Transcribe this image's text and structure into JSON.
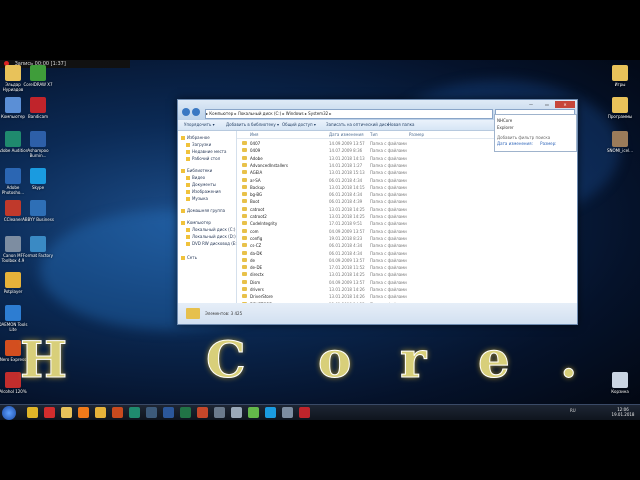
{
  "recording_bar": {
    "label": "Запись 00:00 [1:37]"
  },
  "desktop_icons_left": [
    {
      "label": "Эльдар Нуриадов",
      "icon": "user-folder-icon",
      "color": "#e8c25a"
    },
    {
      "label": "Компьютер",
      "icon": "computer-icon",
      "color": "#5b8fd6"
    },
    {
      "label": "Adobe Audition",
      "icon": "audition-icon",
      "color": "#1f8a6e"
    },
    {
      "label": "Adobe Photosho...",
      "icon": "photoshop-icon",
      "color": "#2b66b3"
    },
    {
      "label": "CCleaner",
      "icon": "ccleaner-icon",
      "color": "#c0392b"
    },
    {
      "label": "Canon MF Toolbox 4.9",
      "icon": "canon-icon",
      "color": "#7d8da1"
    },
    {
      "label": "Potplayer",
      "icon": "potplayer-icon",
      "color": "#e5b23a"
    },
    {
      "label": "DAEMON Tools Lite",
      "icon": "daemon-tools-icon",
      "color": "#2d7dd2"
    },
    {
      "label": "Nero Express",
      "icon": "nero-icon",
      "color": "#d34e1f"
    },
    {
      "label": "Alcohol 120%",
      "icon": "alcohol-icon",
      "color": "#c22d2d"
    }
  ],
  "desktop_icons_left2": [
    {
      "label": "CorelDRAW X7",
      "icon": "coreldraw-icon",
      "color": "#3f9d3a"
    },
    {
      "label": "Bandicam",
      "icon": "bandicam-icon",
      "color": "#c0242b"
    },
    {
      "label": "Ashampoo Burnin...",
      "icon": "ashampoo-icon",
      "color": "#2d5fa8"
    },
    {
      "label": "Skype",
      "icon": "skype-icon",
      "color": "#1a9be0"
    },
    {
      "label": "ABBYY Business",
      "icon": "abbyy-icon",
      "color": "#2e6fb6"
    },
    {
      "label": "Format Factory",
      "icon": "format-factory-icon",
      "color": "#3a8ac4"
    }
  ],
  "desktop_icons_right": [
    {
      "label": "Игры",
      "icon": "games-folder-icon",
      "color": "#e8c25a"
    },
    {
      "label": "Программы",
      "icon": "programs-folder-icon",
      "color": "#e8c25a"
    },
    {
      "label": "SNOMI_icel...",
      "icon": "image-file-icon",
      "color": "#9a7b5a"
    },
    {
      "label": "Корзина",
      "icon": "recycle-bin-icon",
      "color": "#c9d4e2"
    }
  ],
  "explorer": {
    "address": "▸ Компьютер ▸ Локальный диск (C:) ▸ Windows ▸ System32 ▸",
    "toolbar": [
      "Упорядочить ▾",
      "Добавить в библиотеку ▾",
      "Общий доступ ▾",
      "Записать на оптический диск",
      "Новая папка"
    ],
    "nav": [
      {
        "label": "Избранное",
        "icon": "star-icon"
      },
      {
        "label": "Загрузки",
        "icon": "downloads-icon"
      },
      {
        "label": "Недавние места",
        "icon": "recent-icon"
      },
      {
        "label": "Рабочий стол",
        "icon": "desktop-icon"
      },
      {
        "label": "Библиотеки",
        "icon": "libraries-icon"
      },
      {
        "label": "Видео",
        "icon": "video-icon"
      },
      {
        "label": "Документы",
        "icon": "documents-icon"
      },
      {
        "label": "Изображения",
        "icon": "pictures-icon"
      },
      {
        "label": "Музыка",
        "icon": "music-icon"
      },
      {
        "label": "Домашняя группа",
        "icon": "homegroup-icon"
      },
      {
        "label": "Компьютер",
        "icon": "computer-icon"
      },
      {
        "label": "Локальный диск (C:)",
        "icon": "drive-icon"
      },
      {
        "label": "Локальный диск (D:)",
        "icon": "drive-icon"
      },
      {
        "label": "DVD RW дисковод (E:)",
        "icon": "dvd-icon"
      },
      {
        "label": "Сеть",
        "icon": "network-icon"
      }
    ],
    "columns": [
      "Имя",
      "Дата изменения",
      "Тип",
      "Размер"
    ],
    "files": [
      {
        "name": "0407",
        "date": "14.09.2009 13:57",
        "type": "Папка с файлами"
      },
      {
        "name": "0409",
        "date": "14.07.2009 8:36",
        "type": "Папка с файлами"
      },
      {
        "name": "Adobe",
        "date": "13.01.2018 14:13",
        "type": "Папка с файлами"
      },
      {
        "name": "AdvancedInstallers",
        "date": "14.01.2018 1:27",
        "type": "Папка с файлами"
      },
      {
        "name": "AGEIA",
        "date": "13.01.2018 15:13",
        "type": "Папка с файлами"
      },
      {
        "name": "ar-SA",
        "date": "06.01.2018 4:34",
        "type": "Папка с файлами"
      },
      {
        "name": "Backup",
        "date": "13.01.2018 14:15",
        "type": "Папка с файлами"
      },
      {
        "name": "bg-BG",
        "date": "06.01.2018 4:34",
        "type": "Папка с файлами"
      },
      {
        "name": "Boot",
        "date": "06.01.2018 4:39",
        "type": "Папка с файлами"
      },
      {
        "name": "catroot",
        "date": "13.01.2018 14:25",
        "type": "Папка с файлами"
      },
      {
        "name": "catroot2",
        "date": "13.01.2018 14:25",
        "type": "Папка с файлами"
      },
      {
        "name": "CodeIntegrity",
        "date": "17.01.2018 9:51",
        "type": "Папка с файлами"
      },
      {
        "name": "com",
        "date": "04.09.2009 13:57",
        "type": "Папка с файлами"
      },
      {
        "name": "config",
        "date": "19.01.2018 8:23",
        "type": "Папка с файлами"
      },
      {
        "name": "cs-CZ",
        "date": "06.01.2018 4:34",
        "type": "Папка с файлами"
      },
      {
        "name": "da-DK",
        "date": "06.01.2018 4:34",
        "type": "Папка с файлами"
      },
      {
        "name": "de",
        "date": "04.09.2009 13:57",
        "type": "Папка с файлами"
      },
      {
        "name": "de-DE",
        "date": "17.01.2018 11:52",
        "type": "Папка с файлами"
      },
      {
        "name": "directx",
        "date": "13.01.2018 14:25",
        "type": "Папка с файлами"
      },
      {
        "name": "Dism",
        "date": "04.09.2009 13:57",
        "type": "Папка с файлами"
      },
      {
        "name": "drivers",
        "date": "13.01.2018 14:26",
        "type": "Папка с файлами"
      },
      {
        "name": "DriverStore",
        "date": "13.01.2018 14:26",
        "type": "Папка с файлами"
      },
      {
        "name": "DRVSTORE",
        "date": "13.01.2018 14:25",
        "type": "Папка с файлами"
      }
    ],
    "status": "Элементов: 3 425"
  },
  "search_dropdown": {
    "recent": [
      "NHCore",
      "Explorer"
    ],
    "hint": "Добавить фильтр поиска",
    "filters": [
      "Дата изменения:",
      "Размер:"
    ]
  },
  "overlay_letters": [
    "H",
    "C",
    "o",
    "r",
    "e",
    "."
  ],
  "taskbar": {
    "apps": [
      {
        "icon": "chrome-icon",
        "color": "#e0b528"
      },
      {
        "icon": "yandex-icon",
        "color": "#d22d2d"
      },
      {
        "icon": "explorer-folder-icon",
        "color": "#e8c25a"
      },
      {
        "icon": "avast-icon",
        "color": "#f07a1a"
      },
      {
        "icon": "potplayer-icon",
        "color": "#e5b23a"
      },
      {
        "icon": "media-icon",
        "color": "#c84a1e"
      },
      {
        "icon": "audition-icon",
        "color": "#1f8a6e"
      },
      {
        "icon": "steam-icon",
        "color": "#3c5a7a"
      },
      {
        "icon": "word-icon",
        "color": "#2b579a"
      },
      {
        "icon": "excel-icon",
        "color": "#217346"
      },
      {
        "icon": "powerpoint-icon",
        "color": "#c5472a"
      },
      {
        "icon": "calculator-icon",
        "color": "#6b7a8c"
      },
      {
        "icon": "notepad-icon",
        "color": "#9aa9b9"
      },
      {
        "icon": "utorrent-icon",
        "color": "#63b84a"
      },
      {
        "icon": "skype-icon",
        "color": "#1a9be0"
      },
      {
        "icon": "settings-icon",
        "color": "#7d8da1"
      },
      {
        "icon": "bandicam-icon",
        "color": "#c0242b"
      }
    ],
    "lang": "RU",
    "time": "12:06",
    "date": "19.01.2018"
  }
}
